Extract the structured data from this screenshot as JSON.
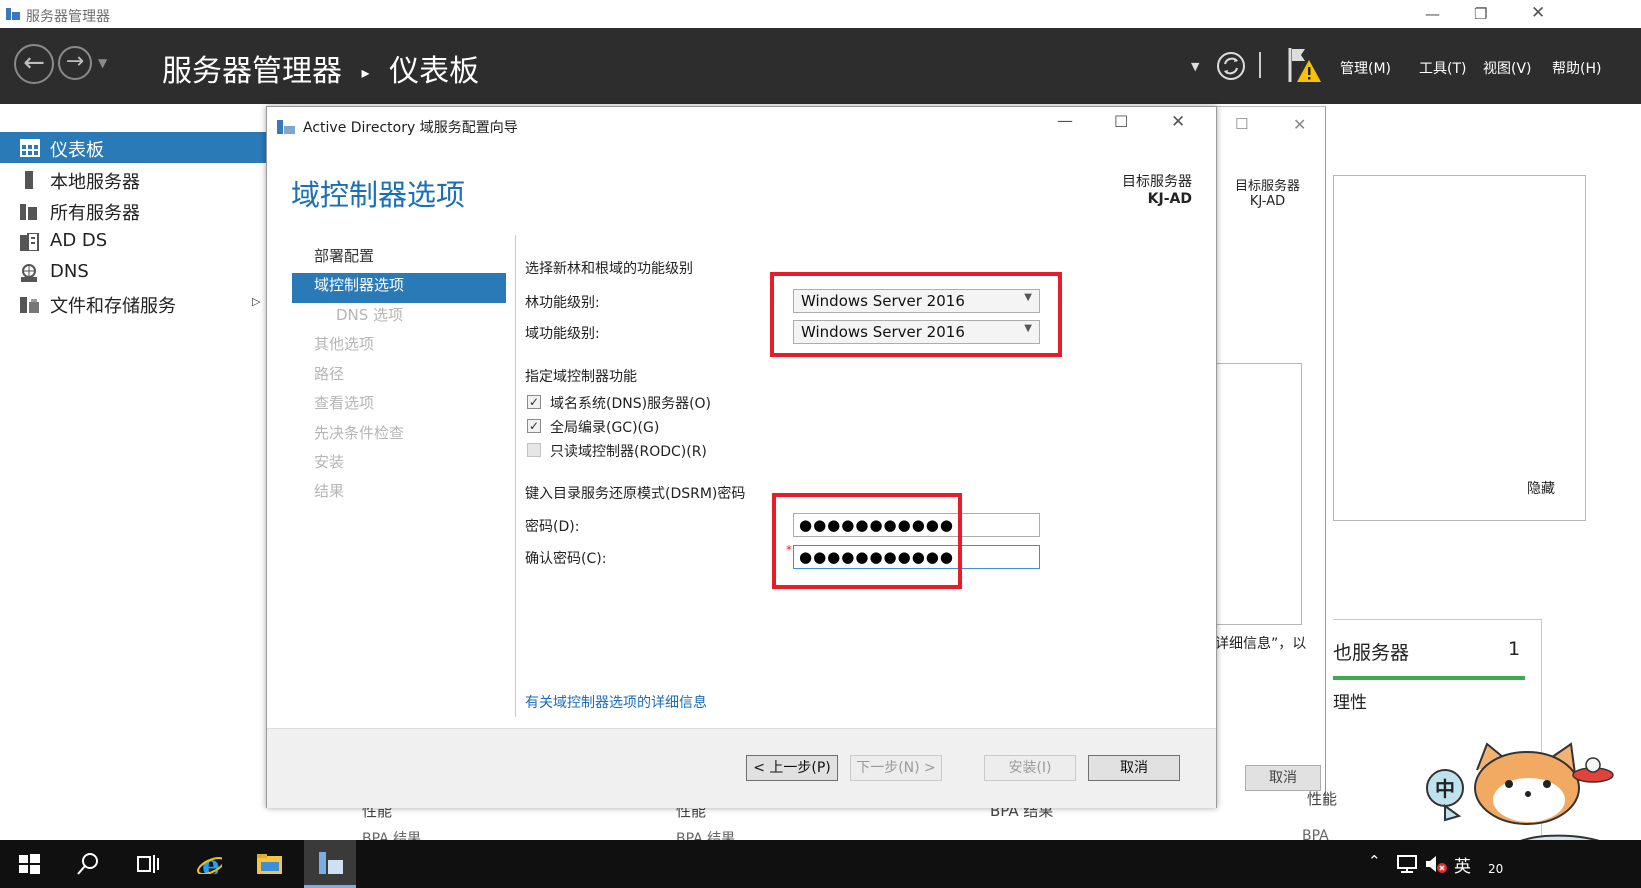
{
  "window": {
    "title": "服务器管理器"
  },
  "header": {
    "breadcrumb_root": "服务器管理器",
    "breadcrumb_sep": "▸",
    "breadcrumb_page": "仪表板",
    "menu": {
      "manage": "管理(M)",
      "tools": "工具(T)",
      "view": "视图(V)",
      "help": "帮助(H)"
    }
  },
  "sidebar": {
    "items": [
      {
        "label": "仪表板"
      },
      {
        "label": "本地服务器"
      },
      {
        "label": "所有服务器"
      },
      {
        "label": "AD DS"
      },
      {
        "label": "DNS"
      },
      {
        "label": "文件和存储服务"
      }
    ]
  },
  "background": {
    "target_label": "目标服务器",
    "target_name": "KJ-AD",
    "hide_label": "隐藏",
    "detail_frag": "详细信息”，以",
    "local_server_frag": "也服务器",
    "local_server_count": "1",
    "manage_frag": "理性",
    "perf_label": "性能",
    "bpa_label": "BPA 结果",
    "cancel": "取消"
  },
  "dialog": {
    "title": "Active Directory 域服务配置向导",
    "heading": "域控制器选项",
    "target_label": "目标服务器",
    "target_name": "KJ-AD",
    "steps": [
      {
        "label": "部署配置"
      },
      {
        "label": "域控制器选项"
      },
      {
        "label": "DNS 选项"
      },
      {
        "label": "其他选项"
      },
      {
        "label": "路径"
      },
      {
        "label": "查看选项"
      },
      {
        "label": "先决条件检查"
      },
      {
        "label": "安装"
      },
      {
        "label": "结果"
      }
    ],
    "functional_level_section": "选择新林和根域的功能级别",
    "forest_level_label": "林功能级别:",
    "forest_level_value": "Windows Server 2016",
    "domain_level_label": "域功能级别:",
    "domain_level_value": "Windows Server 2016",
    "dc_capabilities_section": "指定域控制器功能",
    "cb_dns": "域名系统(DNS)服务器(O)",
    "cb_gc": "全局编录(GC)(G)",
    "cb_rodc": "只读域控制器(RODC)(R)",
    "dsrm_section": "键入目录服务还原模式(DSRM)密码",
    "password_label": "密码(D):",
    "password_value": "●●●●●●●●●●●",
    "confirm_label": "确认密码(C):",
    "confirm_value": "●●●●●●●●●●●",
    "required_mark": "*",
    "more_info_link": "有关域控制器选项的详细信息",
    "buttons": {
      "prev": "< 上一步(P)",
      "next": "下一步(N) >",
      "install": "安装(I)",
      "cancel": "取消"
    }
  },
  "taskbar": {
    "ime_mode": "中",
    "lang": "英",
    "clock_frag": "20"
  },
  "colors": {
    "accent": "#2a7ab8",
    "highlight_box": "#e81d2a",
    "header_bg": "#2d2d2d"
  }
}
